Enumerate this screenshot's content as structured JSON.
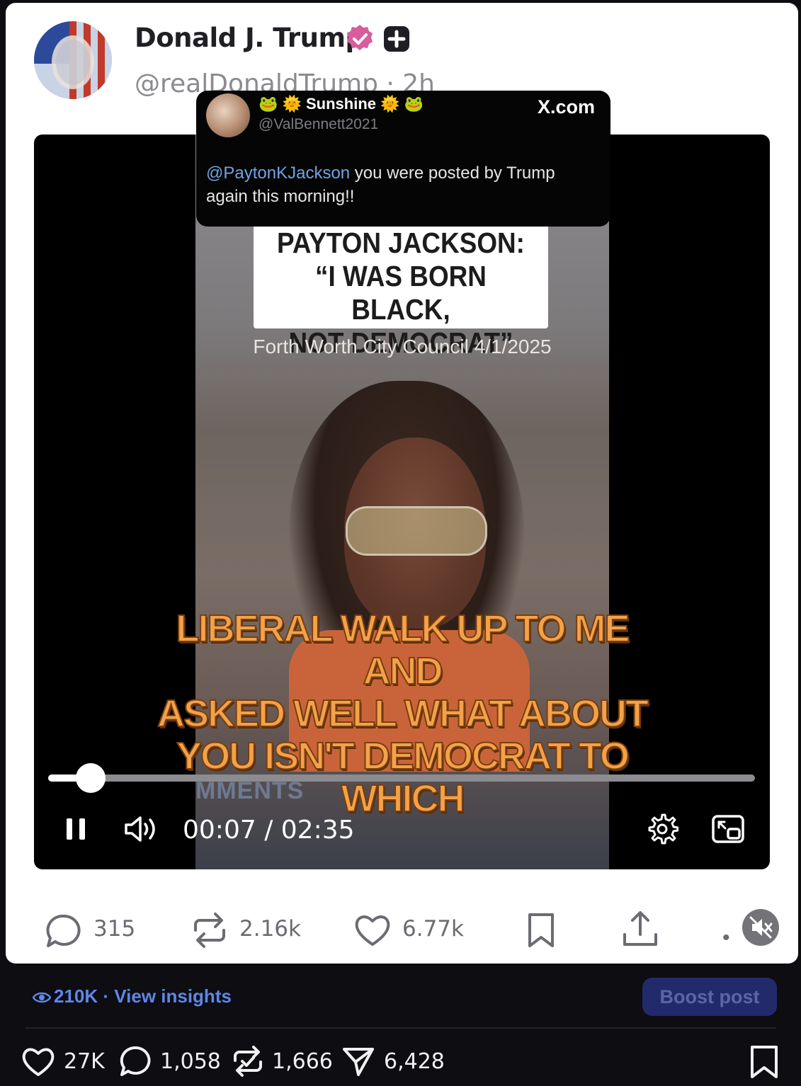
{
  "post": {
    "author_name": "Donald J. Trump",
    "author_handle": "@realDonaldTrump · 2h"
  },
  "quoted_tweet": {
    "name": "🐸 🌞 Sunshine 🌞 🐸",
    "handle": "@ValBennett2021",
    "source": "X.com",
    "mention": "@PaytonKJackson",
    "text": " you were posted by Trump again this morning!!"
  },
  "video": {
    "title_card": [
      "PAYTON JACKSON:",
      "“I WAS BORN BLACK,",
      "NOT DEMOCRAT”"
    ],
    "subtitle": "Forth Worth City Council 4/1/2025",
    "overlay_caption": [
      "LIBERAL WALK UP TO ME AND",
      "ASKED WELL WHAT ABOUT",
      "YOU ISN'T DEMOCRAT TO",
      "WHICH"
    ],
    "partial_text": "MMENTS",
    "current_time": "00:07",
    "duration": "02:35",
    "time_display": "00:07 / 02:35",
    "progress": 0.06,
    "state": "playing"
  },
  "actions": {
    "replies": "315",
    "reposts": "2.16k",
    "likes": "6.77k",
    "more": "•"
  },
  "insights": {
    "views": "210K",
    "label": "View insights",
    "text": "210K · View insights"
  },
  "boost_label": "Boost post",
  "stats": {
    "likes": "27K",
    "comments": "1,058",
    "reposts": "1,666",
    "shares": "6,428"
  },
  "colors": {
    "accent_blue": "#5f86e8",
    "verified_pink": "#d85d9c",
    "caption_orange": "#f3a24a"
  }
}
